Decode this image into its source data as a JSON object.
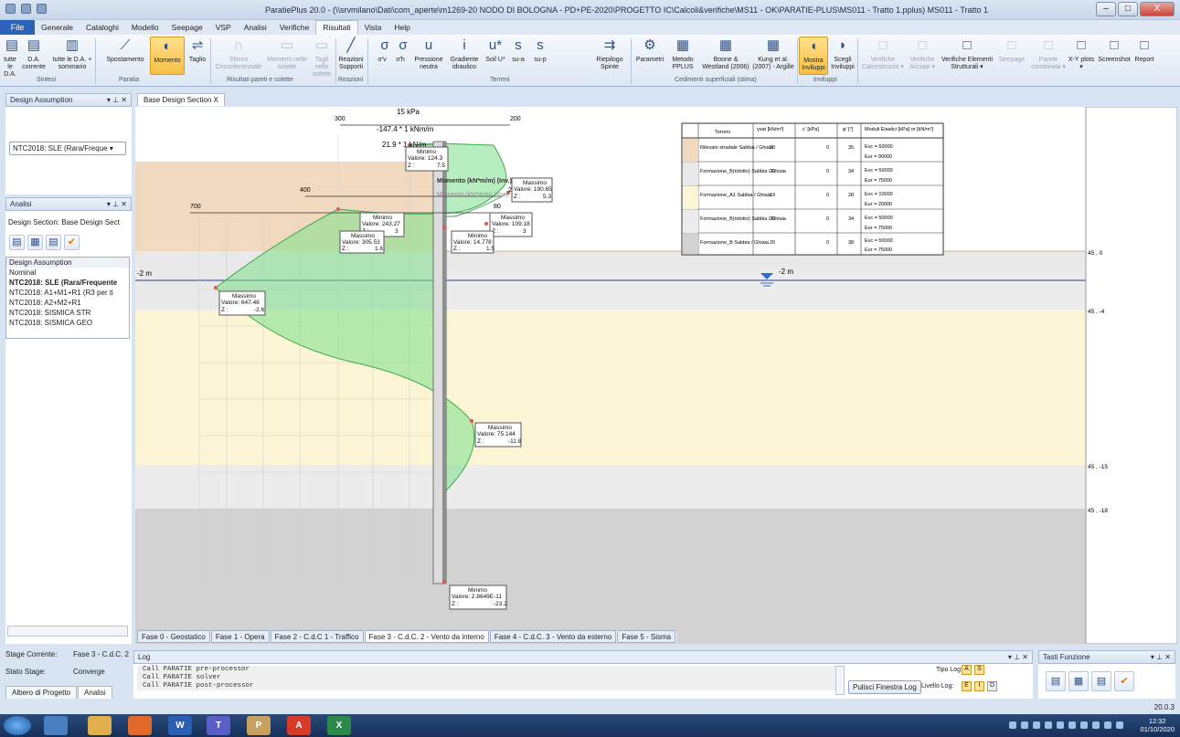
{
  "window": {
    "title": "ParatiePlus 20.0 - (\\\\srvmilano\\Dati\\com_aperte\\m1269-20  NODO DI BOLOGNA - PD+PE-2020\\PROGETTO IC\\Calcoli&verifiche\\MS11 - OK\\PARATIE-PLUS\\MS011 - Tratto 1.pplus) MS011 - Tratto 1",
    "minimize": "–",
    "maximize": "□",
    "close": "X"
  },
  "menu": {
    "file": "File",
    "items": [
      "Generale",
      "Cataloghi",
      "Modello",
      "Seepage",
      "VSP",
      "Analisi",
      "Verifiche",
      "Risultati",
      "Vista",
      "Help"
    ],
    "selected": "Risultati"
  },
  "ribbon": {
    "btn_tutte": "tutte le D.A.",
    "btn_da": "D.A. corrente",
    "btn_tutte_somm": "tutte le D.A. + sommario",
    "btn_spost": "Spostamento",
    "btn_momento": "Momento",
    "btn_taglio": "Taglio",
    "btn_sforzo": "Sforzo Circonferenziale",
    "btn_momenti_sol": "Momenti nelle solette",
    "btn_tagli_sol": "Tagli nelle solette",
    "btn_reazioni": "Reazioni Supporti",
    "btn_sv": "σ'v",
    "btn_sh": "σ'h",
    "btn_press": "Pressione neutra",
    "btn_grad": "Gradiente idraulico",
    "btn_soil": "Soil U*",
    "btn_sua": "su-a",
    "btn_sup": "su-p",
    "btn_riep": "Riepilogo Spinte",
    "btn_param": "Parametri",
    "btn_metodo": "Metodo PPLUS",
    "btn_boone": "Boone & Westland (2006)",
    "btn_kung": "Kung et al. (2007) - Argille",
    "btn_mostra": "Mostra Inviluppi",
    "btn_scegli": "Scegli Inviluppi",
    "btn_vcls": "Verifiche Calcestruzzo ▾",
    "btn_vacc": "Verifiche Acciaio ▾",
    "btn_vel": "Verifiche Elementi Strutturali ▾",
    "btn_seep": "Seepage",
    "btn_parete": "Parete combinata ▾",
    "btn_xy": "X-Y plots ▾",
    "btn_screen": "Screenshot",
    "btn_report": "Report",
    "grp_sintesi": "Sintesi",
    "grp_paratia": "Paratia",
    "grp_risultati": "Risultati pareti e solette",
    "grp_reazioni": "Reazioni",
    "grp_terreni": "Terreni",
    "grp_cedimenti": "Cedimenti superficiali (stima)",
    "grp_inviluppi": "Inviluppi"
  },
  "left": {
    "design_hdr": "Design Assumption",
    "design_combo": "NTC2018: SLE (Rara/Freque ▾",
    "analisi_hdr": "Analisi",
    "design_section_label": "Design Section:  Base Design Sect",
    "list_header": "Design Assumption",
    "list": [
      "Nominal",
      "NTC2018: SLE (Rara/Frequente",
      "NTC2018: A1+M1+R1 (R3 per ti",
      "NTC2018: A2+M2+R1",
      "NTC2018: SISMICA STR",
      "NTC2018: SISMICA GEO"
    ],
    "stage_label": "Stage Corrente:",
    "stage_value": "Fase 3 - C.d.C. 2",
    "stato_label": "Stato Stage:",
    "stato_value": "Converge",
    "tab_albero": "Albero di Progetto",
    "tab_analisi": "Analisi"
  },
  "doc": {
    "tab": "Base Design Section",
    "tab_close": "X"
  },
  "stages": [
    "Fase 0 - Geostatico",
    "Fase 1 - Opera",
    "Fase 2 - C.d.C 1 - Traffico",
    "Fase 3 - C.d.C. 2 - Vento da interno",
    "Fase 4 - C.d.C. 3 - Vento da esterno",
    "Fase 5 - Sisma"
  ],
  "stage_selected": 3,
  "diagram": {
    "loads": [
      "15 kPa",
      "-147.4 * 1 kNm/m",
      "21.9 * 1 kN/m"
    ],
    "scale_top": [
      "300",
      "200"
    ],
    "scale_mid": [
      "400",
      "200"
    ],
    "scale_low": [
      "700",
      "80"
    ],
    "mom_label1": "Momento (kN*m/m) (Inv.)",
    "mom_label2": "Momento (kN*m/m) (Inv.)",
    "water": "-2 m",
    "water_left": "-2 m",
    "elev": [
      "45 , 0",
      "45 , -4",
      "45 , -15",
      "45 , -18"
    ],
    "boxes": [
      {
        "t": "Minimo",
        "v": "Valore: 124.3",
        "z": "Z :",
        "zv": "7.5"
      },
      {
        "t": "Massimo",
        "v": "Valore: 190.65",
        "z": "Z :",
        "zv": "5.3"
      },
      {
        "t": "Minimo",
        "v": "Valore: 243.27",
        "z": "Z :",
        "zv": "3"
      },
      {
        "t": "Massimo",
        "v": "Valore: 109.18",
        "z": "Z :",
        "zv": "3"
      },
      {
        "t": "Massimo",
        "v": "Valore: 305.53",
        "z": "Z :",
        "zv": "1.6"
      },
      {
        "t": "Minimo",
        "v": "Valore: 14.778",
        "z": "Z :",
        "zv": "1.5"
      },
      {
        "t": "Massimo",
        "v": "Valore: 647.48",
        "z": "Z :",
        "zv": "-2.6"
      },
      {
        "t": "Massimo",
        "v": "Valore: 75.144",
        "z": "Z :",
        "zv": "-11.8"
      },
      {
        "t": "Minimo",
        "v": "Valore: 2.8649E-11",
        "z": "Z :",
        "zv": "-23.2"
      }
    ],
    "soil_table": {
      "headers": [
        "Terreni",
        "γsat [kN/m³]",
        "c' [kPa]",
        "φ' [°]",
        "Moduli Elastici [kPa] or [kN/m³]"
      ],
      "rows": [
        [
          "Rilevato stradale\nSabbia / Ghiaia",
          "20",
          "0",
          "35",
          "Evc = 60000",
          "Eur = 90000"
        ],
        [
          "Formazione_B(ridotto)\nSabbia / Ghiaia",
          "20",
          "0",
          "34",
          "Evc = 50000",
          "Eur = 75000"
        ],
        [
          "Formazione_A1\nSabbia / Ghiaia",
          "19",
          "0",
          "28",
          "Evc = 10000",
          "Eur = 20000"
        ],
        [
          "Formazione_B(ridotto)\nSabbia / Ghiaia",
          "20",
          "0",
          "34",
          "Evc = 50000",
          "Eur = 75000"
        ],
        [
          "Formazione_B\nSabbia / Ghiaia",
          "20",
          "0",
          "38",
          "Evc = 50000",
          "Eur = 75000"
        ]
      ],
      "colors": [
        "#f1d9c0",
        "#e9e9e9",
        "#fbf5d6",
        "#ececec",
        "#d2d2d2"
      ]
    }
  },
  "log": {
    "hdr": "Log",
    "lines": [
      "Call PARATIE pre-processor",
      "Call PARATIE solver",
      "Call PARATIE post-processor"
    ],
    "clear": "Pulisci Finestra Log",
    "tipo": "Tipo Log:",
    "livello": "Livello Log:",
    "tipo_a": "A",
    "tipo_s": "S",
    "lv_e": "E",
    "lv_i": "I",
    "lv_d": "D"
  },
  "tasti": {
    "hdr": "Tasti Funzione"
  },
  "version": "20.0.3",
  "clock": {
    "time": "12:32",
    "date": "01/10/2020"
  }
}
